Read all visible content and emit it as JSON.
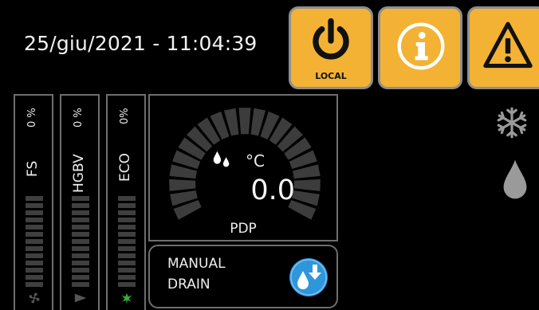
{
  "header": {
    "datetime": "25/giu/2021 - 11:04:39"
  },
  "toolbar": {
    "power": {
      "icon": "power-icon",
      "caption": "LOCAL"
    },
    "info": {
      "icon": "info-icon"
    },
    "alarm": {
      "icon": "warning-icon"
    }
  },
  "bars": [
    {
      "name": "FS",
      "value": "0 %",
      "icon": "fan-icon"
    },
    {
      "name": "HGBV",
      "value": "0 %",
      "icon": "valve-icon"
    },
    {
      "name": "ECO",
      "value": "0%",
      "icon": "eco-leaf-icon"
    }
  ],
  "gauge": {
    "icon": "water-drops-icon",
    "unit": "°C",
    "value": "0.0",
    "label": "PDP",
    "level": 0
  },
  "drain": {
    "line1": "MANUAL",
    "line2": "DRAIN",
    "icon": "drain-icon"
  },
  "status_icons": [
    "snowflake-icon",
    "water-drop-icon"
  ],
  "colors": {
    "accent": "#f3b233",
    "button_border": "#8e8e8e",
    "drain_button": "#2f96dc",
    "inactive_segment": "#3f3f3f",
    "eco_icon": "#3aa835"
  }
}
